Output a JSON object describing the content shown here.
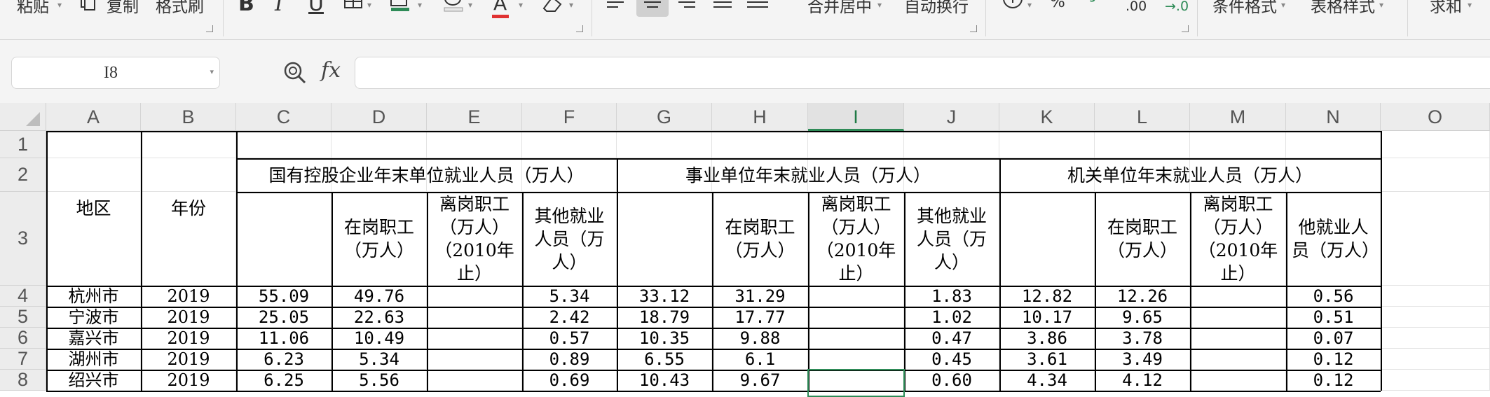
{
  "ribbon": {
    "paste_label": "粘贴",
    "copy_label": "复制",
    "format_painter_label": "格式刷",
    "bold_glyph": "B",
    "italic_glyph": "I",
    "underline_glyph": "U",
    "font_color_glyph": "A",
    "merge_center_label": "合并居中",
    "auto_wrap_label": "自动换行",
    "percent_glyph": "%",
    "comma_glyph": "⁹",
    "inc_decimal_label": ".00",
    "dec_decimal_label": "→.0",
    "conditional_format_label": "条件格式",
    "table_style_label": "表格样式",
    "sum_label": "求和",
    "icons": [
      "copy-icon",
      "border-icon",
      "fill-color-icon",
      "clear-format-icon",
      "align-left-icon",
      "align-center-icon",
      "align-right-icon",
      "justify-icon",
      "distributed-icon",
      "currency-icon"
    ]
  },
  "formula_bar": {
    "cell_reference": "I8",
    "fx_label": "fx",
    "formula": ""
  },
  "columns": [
    "A",
    "B",
    "C",
    "D",
    "E",
    "F",
    "G",
    "H",
    "I",
    "J",
    "K",
    "L",
    "M",
    "N",
    "O"
  ],
  "selected_column": "I",
  "rows": [
    "1",
    "2",
    "3",
    "4",
    "5",
    "6",
    "7",
    "8"
  ],
  "sheet": {
    "region_header": "地区",
    "year_header": "年份",
    "group1_title": "国有控股企业年末单位就业人员（万人）",
    "group2_title": "事业单位年末就业人员（万人）",
    "group3_title": "机关单位年末就业人员（万人）",
    "sub_on_post": "在岗职工（万人）",
    "sub_off_post": "离岗职工（万人）（2010年止）",
    "sub_other_a": "其他就业人员（万人）",
    "sub_other_b": "其他就业人员（万人）",
    "sub_other_c": "他就业人员（万人）",
    "data_rows": [
      {
        "region": "杭州市",
        "year": "2019",
        "c": "55.09",
        "d": "49.76",
        "e": "",
        "f": "5.34",
        "g": "33.12",
        "h": "31.29",
        "i": "",
        "j": "1.83",
        "k": "12.82",
        "l": "12.26",
        "m": "",
        "n": "0.56"
      },
      {
        "region": "宁波市",
        "year": "2019",
        "c": "25.05",
        "d": "22.63",
        "e": "",
        "f": "2.42",
        "g": "18.79",
        "h": "17.77",
        "i": "",
        "j": "1.02",
        "k": "10.17",
        "l": "9.65",
        "m": "",
        "n": "0.51"
      },
      {
        "region": "嘉兴市",
        "year": "2019",
        "c": "11.06",
        "d": "10.49",
        "e": "",
        "f": "0.57",
        "g": "10.35",
        "h": "9.88",
        "i": "",
        "j": "0.47",
        "k": "3.86",
        "l": "3.78",
        "m": "",
        "n": "0.07"
      },
      {
        "region": "湖州市",
        "year": "2019",
        "c": "6.23",
        "d": "5.34",
        "e": "",
        "f": "0.89",
        "g": "6.55",
        "h": "6.1",
        "i": "",
        "j": "0.45",
        "k": "3.61",
        "l": "3.49",
        "m": "",
        "n": "0.12"
      },
      {
        "region": "绍兴市",
        "year": "2019",
        "c": "6.25",
        "d": "5.56",
        "e": "",
        "f": "0.69",
        "g": "10.43",
        "h": "9.67",
        "i": "",
        "j": "0.60",
        "k": "4.34",
        "l": "4.12",
        "m": "",
        "n": "0.12"
      }
    ]
  }
}
